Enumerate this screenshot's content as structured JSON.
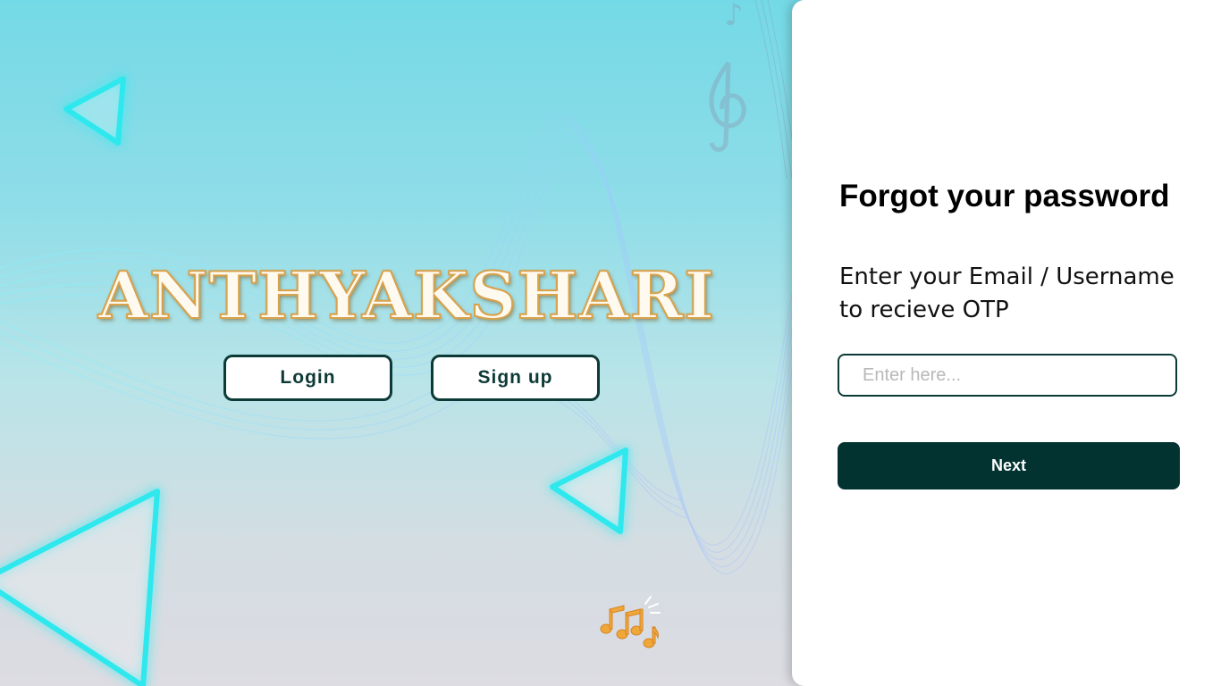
{
  "hero": {
    "title": "ANTHYAKSHARI",
    "login_label": "Login",
    "signup_label": "Sign up"
  },
  "forgot_password": {
    "title": "Forgot your password",
    "instruction": "Enter your Email / Username to recieve OTP",
    "input_placeholder": "Enter here...",
    "input_value": "",
    "next_label": "Next"
  },
  "icons": {
    "triangles": "play-triangle-icon",
    "music_notes": "music-notes-icon",
    "clef": "treble-clef-icon"
  },
  "colors": {
    "primary_dark": "#033331",
    "button_border": "#0c3a36",
    "accent_cyan": "#2ee8ee",
    "title_gold": "#d9a24b",
    "notes_orange": "#f0a73a"
  }
}
